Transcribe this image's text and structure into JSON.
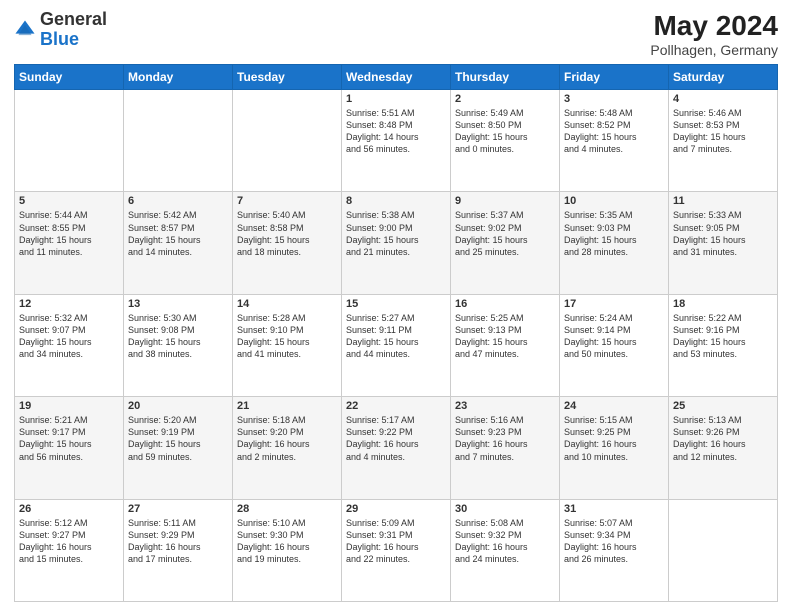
{
  "logo": {
    "general": "General",
    "blue": "Blue"
  },
  "header": {
    "month_year": "May 2024",
    "location": "Pollhagen, Germany"
  },
  "weekdays": [
    "Sunday",
    "Monday",
    "Tuesday",
    "Wednesday",
    "Thursday",
    "Friday",
    "Saturday"
  ],
  "weeks": [
    [
      {
        "day": "",
        "info": ""
      },
      {
        "day": "",
        "info": ""
      },
      {
        "day": "",
        "info": ""
      },
      {
        "day": "1",
        "info": "Sunrise: 5:51 AM\nSunset: 8:48 PM\nDaylight: 14 hours\nand 56 minutes."
      },
      {
        "day": "2",
        "info": "Sunrise: 5:49 AM\nSunset: 8:50 PM\nDaylight: 15 hours\nand 0 minutes."
      },
      {
        "day": "3",
        "info": "Sunrise: 5:48 AM\nSunset: 8:52 PM\nDaylight: 15 hours\nand 4 minutes."
      },
      {
        "day": "4",
        "info": "Sunrise: 5:46 AM\nSunset: 8:53 PM\nDaylight: 15 hours\nand 7 minutes."
      }
    ],
    [
      {
        "day": "5",
        "info": "Sunrise: 5:44 AM\nSunset: 8:55 PM\nDaylight: 15 hours\nand 11 minutes."
      },
      {
        "day": "6",
        "info": "Sunrise: 5:42 AM\nSunset: 8:57 PM\nDaylight: 15 hours\nand 14 minutes."
      },
      {
        "day": "7",
        "info": "Sunrise: 5:40 AM\nSunset: 8:58 PM\nDaylight: 15 hours\nand 18 minutes."
      },
      {
        "day": "8",
        "info": "Sunrise: 5:38 AM\nSunset: 9:00 PM\nDaylight: 15 hours\nand 21 minutes."
      },
      {
        "day": "9",
        "info": "Sunrise: 5:37 AM\nSunset: 9:02 PM\nDaylight: 15 hours\nand 25 minutes."
      },
      {
        "day": "10",
        "info": "Sunrise: 5:35 AM\nSunset: 9:03 PM\nDaylight: 15 hours\nand 28 minutes."
      },
      {
        "day": "11",
        "info": "Sunrise: 5:33 AM\nSunset: 9:05 PM\nDaylight: 15 hours\nand 31 minutes."
      }
    ],
    [
      {
        "day": "12",
        "info": "Sunrise: 5:32 AM\nSunset: 9:07 PM\nDaylight: 15 hours\nand 34 minutes."
      },
      {
        "day": "13",
        "info": "Sunrise: 5:30 AM\nSunset: 9:08 PM\nDaylight: 15 hours\nand 38 minutes."
      },
      {
        "day": "14",
        "info": "Sunrise: 5:28 AM\nSunset: 9:10 PM\nDaylight: 15 hours\nand 41 minutes."
      },
      {
        "day": "15",
        "info": "Sunrise: 5:27 AM\nSunset: 9:11 PM\nDaylight: 15 hours\nand 44 minutes."
      },
      {
        "day": "16",
        "info": "Sunrise: 5:25 AM\nSunset: 9:13 PM\nDaylight: 15 hours\nand 47 minutes."
      },
      {
        "day": "17",
        "info": "Sunrise: 5:24 AM\nSunset: 9:14 PM\nDaylight: 15 hours\nand 50 minutes."
      },
      {
        "day": "18",
        "info": "Sunrise: 5:22 AM\nSunset: 9:16 PM\nDaylight: 15 hours\nand 53 minutes."
      }
    ],
    [
      {
        "day": "19",
        "info": "Sunrise: 5:21 AM\nSunset: 9:17 PM\nDaylight: 15 hours\nand 56 minutes."
      },
      {
        "day": "20",
        "info": "Sunrise: 5:20 AM\nSunset: 9:19 PM\nDaylight: 15 hours\nand 59 minutes."
      },
      {
        "day": "21",
        "info": "Sunrise: 5:18 AM\nSunset: 9:20 PM\nDaylight: 16 hours\nand 2 minutes."
      },
      {
        "day": "22",
        "info": "Sunrise: 5:17 AM\nSunset: 9:22 PM\nDaylight: 16 hours\nand 4 minutes."
      },
      {
        "day": "23",
        "info": "Sunrise: 5:16 AM\nSunset: 9:23 PM\nDaylight: 16 hours\nand 7 minutes."
      },
      {
        "day": "24",
        "info": "Sunrise: 5:15 AM\nSunset: 9:25 PM\nDaylight: 16 hours\nand 10 minutes."
      },
      {
        "day": "25",
        "info": "Sunrise: 5:13 AM\nSunset: 9:26 PM\nDaylight: 16 hours\nand 12 minutes."
      }
    ],
    [
      {
        "day": "26",
        "info": "Sunrise: 5:12 AM\nSunset: 9:27 PM\nDaylight: 16 hours\nand 15 minutes."
      },
      {
        "day": "27",
        "info": "Sunrise: 5:11 AM\nSunset: 9:29 PM\nDaylight: 16 hours\nand 17 minutes."
      },
      {
        "day": "28",
        "info": "Sunrise: 5:10 AM\nSunset: 9:30 PM\nDaylight: 16 hours\nand 19 minutes."
      },
      {
        "day": "29",
        "info": "Sunrise: 5:09 AM\nSunset: 9:31 PM\nDaylight: 16 hours\nand 22 minutes."
      },
      {
        "day": "30",
        "info": "Sunrise: 5:08 AM\nSunset: 9:32 PM\nDaylight: 16 hours\nand 24 minutes."
      },
      {
        "day": "31",
        "info": "Sunrise: 5:07 AM\nSunset: 9:34 PM\nDaylight: 16 hours\nand 26 minutes."
      },
      {
        "day": "",
        "info": ""
      }
    ]
  ]
}
